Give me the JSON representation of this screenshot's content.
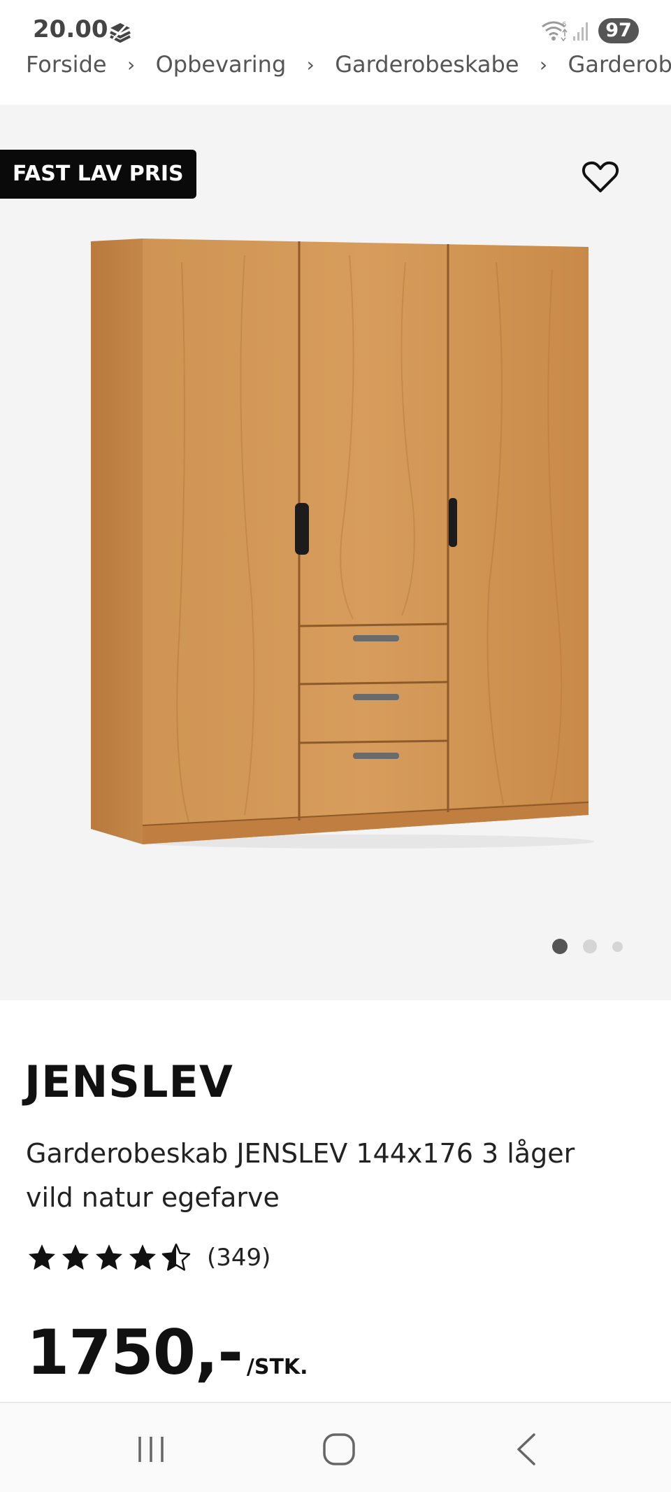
{
  "status_bar": {
    "time": "20.00",
    "battery": "97"
  },
  "breadcrumb": {
    "items": [
      "Forside",
      "Opbevaring",
      "Garderobeskabe",
      "Garderobe"
    ]
  },
  "product": {
    "badge": "FAST LAV PRIS",
    "brand": "JENSLEV",
    "description_line1": "Garderobeskab JENSLEV 144x176 3 låger",
    "description_line2": "vild natur egefarve",
    "rating": 4.5,
    "review_count": "(349)",
    "price": "1750,-",
    "price_unit": "/STK.",
    "image_count": 3,
    "active_image": 0
  },
  "colors": {
    "image_background": "#f4f4f4",
    "badge_background": "#0a0a0a",
    "wood": "#c98b4a"
  },
  "icons": {
    "favorite": "heart-outline-icon",
    "nav_recent": "recent-apps-icon",
    "nav_home": "home-icon",
    "nav_back": "back-icon"
  }
}
